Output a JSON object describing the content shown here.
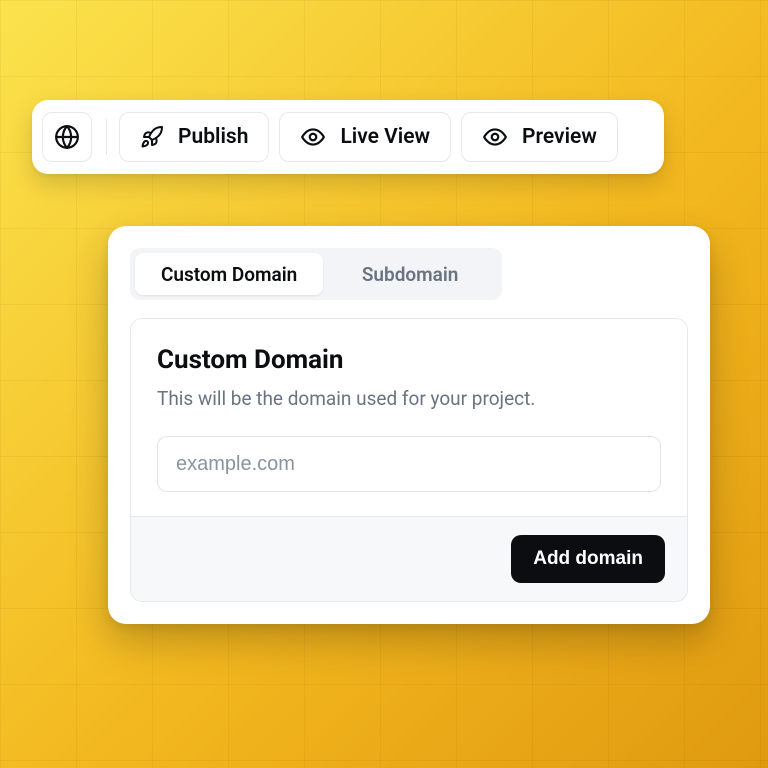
{
  "toolbar": {
    "publish_label": "Publish",
    "live_view_label": "Live View",
    "preview_label": "Preview"
  },
  "tabs": {
    "custom_domain": "Custom Domain",
    "subdomain": "Subdomain"
  },
  "panel": {
    "title": "Custom Domain",
    "description": "This will be the domain used for your project.",
    "placeholder": "example.com",
    "value": "",
    "submit_label": "Add domain"
  }
}
